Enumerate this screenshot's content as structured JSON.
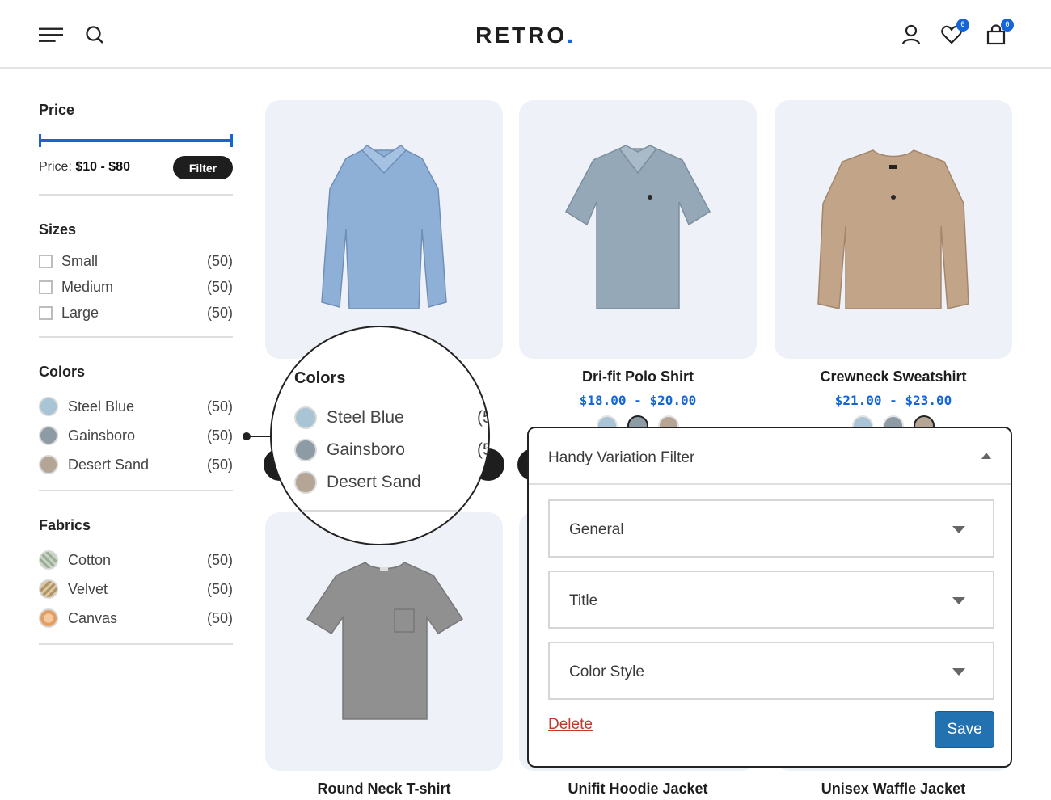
{
  "header": {
    "logo_text": "RETRO",
    "logo_dot": ".",
    "wishlist_count": "0",
    "cart_count": "0"
  },
  "sidebar": {
    "price": {
      "title": "Price",
      "label": "Price:",
      "range": "$10 - $80",
      "filter_label": "Filter"
    },
    "sizes": {
      "title": "Sizes",
      "items": [
        {
          "label": "Small",
          "count": "(50)"
        },
        {
          "label": "Medium",
          "count": "(50)"
        },
        {
          "label": "Large",
          "count": "(50)"
        }
      ]
    },
    "colors": {
      "title": "Colors",
      "items": [
        {
          "label": "Steel Blue",
          "count": "(50)",
          "color": "#a9c4d4"
        },
        {
          "label": "Gainsboro",
          "count": "(50)",
          "color": "#8d9ba5"
        },
        {
          "label": "Desert Sand",
          "count": "(50)",
          "color": "#b5a595"
        }
      ]
    },
    "fabrics": {
      "title": "Fabrics",
      "items": [
        {
          "label": "Cotton",
          "count": "(50)",
          "color": "#a9b9a3"
        },
        {
          "label": "Velvet",
          "count": "(50)",
          "color": "#c2a77e"
        },
        {
          "label": "Canvas",
          "count": "(50)",
          "color": "#ecb584"
        }
      ]
    }
  },
  "magnifier": {
    "title": "Colors",
    "items": [
      {
        "label": "Steel Blue",
        "count": "(5",
        "color": "#a9c4d4"
      },
      {
        "label": "Gainsboro",
        "count": "(5",
        "color": "#8d9ba5"
      },
      {
        "label": "Desert Sand",
        "count": "(",
        "color": "#b5a595"
      }
    ]
  },
  "products": [
    {
      "name": "",
      "price": "",
      "color": "#8fb0d6"
    },
    {
      "name": "Dri-fit Polo Shirt",
      "price": "$18.00 - $20.00",
      "color": "#94a8b8"
    },
    {
      "name": "Crewneck Sweatshirt",
      "price": "$21.00 - $23.00",
      "color": "#c2a488"
    },
    {
      "name": "Round Neck T-shirt",
      "price": "",
      "color": "#909090"
    },
    {
      "name": "Unifit Hoodie Jacket",
      "price": ""
    },
    {
      "name": "Unisex Waffle Jacket",
      "price": ""
    }
  ],
  "panel": {
    "title": "Handy Variation Filter",
    "sections": [
      "General",
      "Title",
      "Color Style"
    ],
    "delete_label": "Delete",
    "save_label": "Save"
  },
  "colors": {
    "accent": "#1565d8",
    "button_dark": "#1e1e1e",
    "save_button": "#2271b1",
    "delete_link": "#c0392b",
    "card_bg": "#eef2f8"
  }
}
